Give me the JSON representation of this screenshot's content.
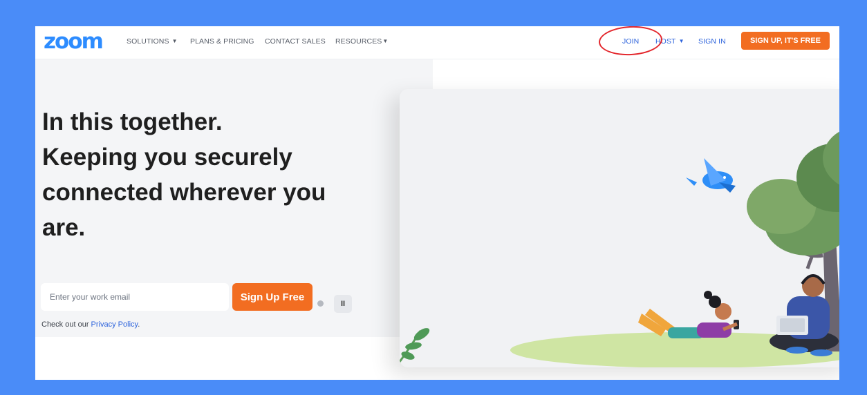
{
  "header": {
    "logo": "zoom",
    "nav": {
      "solutions": "SOLUTIONS",
      "plans": "PLANS & PRICING",
      "contact": "CONTACT SALES",
      "resources": "RESOURCES"
    },
    "join": "JOIN",
    "host": "HOST",
    "sign_in": "SIGN IN",
    "signup": "SIGN UP, IT'S FREE"
  },
  "hero": {
    "line1": "In this together.",
    "line2": "Keeping you securely",
    "line3": "connected wherever you",
    "line4": "are.",
    "email_placeholder": "Enter your work email",
    "signup_button": "Sign Up Free",
    "pause_symbol": "II",
    "privacy_prefix": "Check out our ",
    "privacy_link": "Privacy Policy",
    "privacy_suffix": "."
  },
  "colors": {
    "frame": "#4a8cf8",
    "brand_blue": "#2d8cff",
    "link_blue": "#2d63dc",
    "orange": "#f26d21",
    "annotation_red": "#e3262c"
  },
  "icons": {
    "caret": "chevron-down-icon",
    "pause": "pause-icon"
  }
}
